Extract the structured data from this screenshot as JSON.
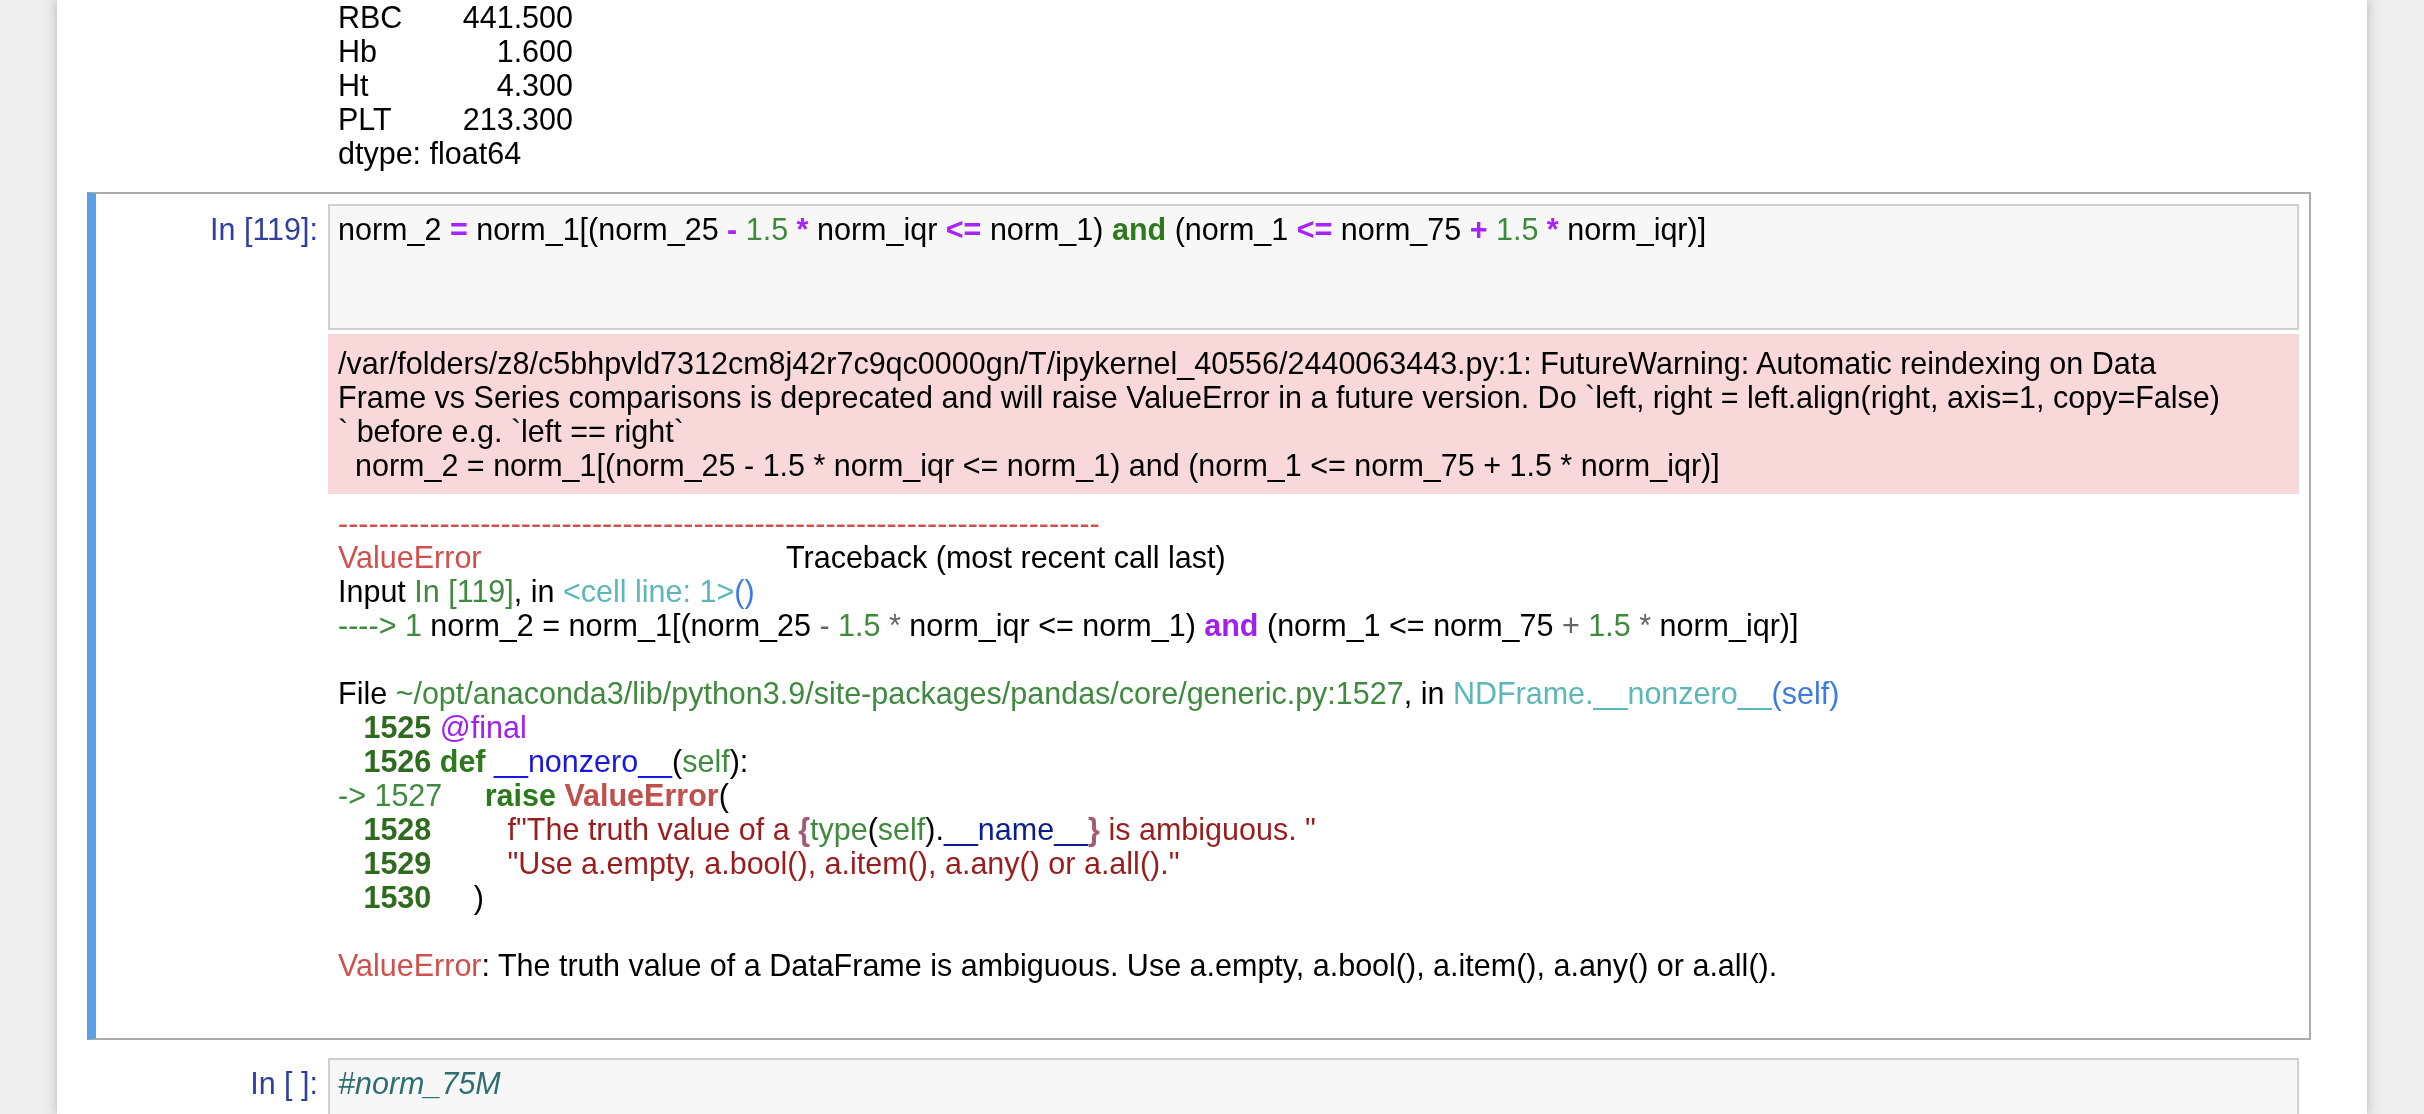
{
  "output_above": {
    "series": [
      {
        "index": "RBC",
        "value": "441.500"
      },
      {
        "index": "Hb",
        "value": "1.600"
      },
      {
        "index": "Ht",
        "value": "4.300"
      },
      {
        "index": "PLT",
        "value": "213.300"
      }
    ],
    "dtype": "dtype: float64"
  },
  "cells": [
    {
      "prompt": "In [119]:",
      "selected": true,
      "code": [
        [
          {
            "kind": "plain",
            "text": "norm_2 "
          },
          {
            "kind": "op",
            "text": "="
          },
          {
            "kind": "plain",
            "text": " norm_1[(norm_25 "
          },
          {
            "kind": "op",
            "text": "-"
          },
          {
            "kind": "num",
            "text": " 1.5 "
          },
          {
            "kind": "op",
            "text": "*"
          },
          {
            "kind": "plain",
            "text": " norm_iqr "
          },
          {
            "kind": "op",
            "text": "<="
          },
          {
            "kind": "plain",
            "text": " norm_1) "
          },
          {
            "kind": "kw",
            "text": "and"
          },
          {
            "kind": "plain",
            "text": " (norm_1 "
          },
          {
            "kind": "op",
            "text": "<="
          },
          {
            "kind": "plain",
            "text": " norm_75 "
          },
          {
            "kind": "op",
            "text": "+"
          },
          {
            "kind": "num",
            "text": " 1.5 "
          },
          {
            "kind": "op",
            "text": "*"
          },
          {
            "kind": "plain",
            "text": " norm_iqr)]"
          }
        ]
      ],
      "stderr": [
        "/var/folders/z8/c5bhpvld7312cm8j42r7c9qc0000gn/T/ipykernel_40556/2440063443.py:1: FutureWarning: Automatic reindexing on Data",
        "Frame vs Series comparisons is deprecated and will raise ValueError in a future version. Do `left, right = left.align(right, axis=1, copy=False)",
        "` before e.g. `left == right`",
        "  norm_2 = norm_1[(norm_25 - 1.5 * norm_iqr <= norm_1) and (norm_1 <= norm_75 + 1.5 * norm_iqr)]"
      ],
      "traceback": [
        {
          "lines": [
            [
              {
                "kind": "err",
                "text": "---------------------------------------------------------------------------"
              }
            ],
            [
              {
                "kind": "err",
                "text": "ValueError"
              },
              {
                "kind": "plain",
                "text": "                                    Traceback (most recent call last)"
              }
            ],
            [
              {
                "kind": "plain",
                "text": "Input "
              },
              {
                "kind": "path",
                "text": "In [119]"
              },
              {
                "kind": "plain",
                "text": ", in "
              },
              {
                "kind": "cyan",
                "text": "<cell line: 1>"
              },
              {
                "kind": "blue",
                "text": "()"
              }
            ],
            [
              {
                "kind": "path",
                "text": "----> 1 "
              },
              {
                "kind": "plain",
                "text": "norm_2 = norm_1[(norm_25 "
              },
              {
                "kind": "dim",
                "text": "-"
              },
              {
                "kind": "num",
                "text": " 1.5 "
              },
              {
                "kind": "dim",
                "text": "*"
              },
              {
                "kind": "plain",
                "text": " norm_iqr <= norm_1) "
              },
              {
                "kind": "kwp",
                "text": "and"
              },
              {
                "kind": "plain",
                "text": " (norm_1 <= norm_75 "
              },
              {
                "kind": "dim",
                "text": "+"
              },
              {
                "kind": "num",
                "text": " 1.5 "
              },
              {
                "kind": "dim",
                "text": "*"
              },
              {
                "kind": "plain",
                "text": " norm_iqr)]"
              }
            ]
          ]
        },
        {
          "lines": [
            [
              {
                "kind": "plain",
                "text": "File "
              },
              {
                "kind": "path",
                "text": "~/opt/anaconda3/lib/python3.9/site-packages/pandas/core/generic.py:1527"
              },
              {
                "kind": "plain",
                "text": ", in "
              },
              {
                "kind": "cyan",
                "text": "NDFrame.__nonzero__"
              },
              {
                "kind": "blue",
                "text": "(self)"
              }
            ],
            [
              {
                "kind": "lineno",
                "text": "   1525 "
              },
              {
                "kind": "deco",
                "text": "@final"
              }
            ],
            [
              {
                "kind": "lineno",
                "text": "   1526 "
              },
              {
                "kind": "kw",
                "text": "def "
              },
              {
                "kind": "func",
                "text": "__nonzero__"
              },
              {
                "kind": "plain",
                "text": "("
              },
              {
                "kind": "path",
                "text": "self"
              },
              {
                "kind": "plain",
                "text": "):"
              }
            ],
            [
              {
                "kind": "path",
                "text": "-> 1527"
              },
              {
                "kind": "kw",
                "text": "     raise "
              },
              {
                "kind": "errb",
                "text": "ValueError"
              },
              {
                "kind": "plain",
                "text": "("
              }
            ],
            [
              {
                "kind": "lineno",
                "text": "   1528"
              },
              {
                "kind": "str",
                "text": "         f\"The truth value of a "
              },
              {
                "kind": "interp",
                "text": "{"
              },
              {
                "kind": "path",
                "text": "type"
              },
              {
                "kind": "plain",
                "text": "("
              },
              {
                "kind": "path",
                "text": "self"
              },
              {
                "kind": "plain",
                "text": ")."
              },
              {
                "kind": "navy",
                "text": "__name__"
              },
              {
                "kind": "interp",
                "text": "}"
              },
              {
                "kind": "str",
                "text": " is ambiguous. \""
              }
            ],
            [
              {
                "kind": "lineno",
                "text": "   1529"
              },
              {
                "kind": "str",
                "text": "         \"Use a.empty, a.bool(), a.item(), a.any() or a.all().\""
              }
            ],
            [
              {
                "kind": "lineno",
                "text": "   1530"
              },
              {
                "kind": "plain",
                "text": "     )"
              }
            ]
          ]
        },
        {
          "lines": [
            [
              {
                "kind": "err",
                "text": "ValueError"
              },
              {
                "kind": "plain",
                "text": ": The truth value of a DataFrame is ambiguous. Use a.empty, a.bool(), a.item(), a.any() or a.all()."
              }
            ]
          ]
        }
      ]
    },
    {
      "prompt": "In [ ]:",
      "selected": false,
      "code": [
        [
          {
            "kind": "comment",
            "text": "#norm_75M"
          }
        ]
      ]
    }
  ]
}
